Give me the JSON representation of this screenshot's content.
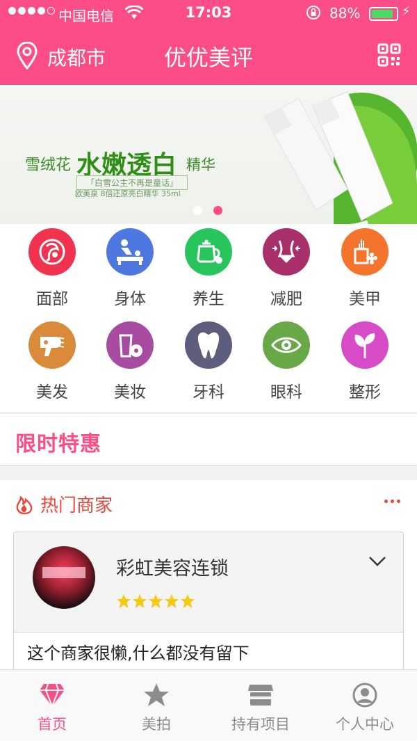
{
  "status_bar": {
    "carrier": "中国电信",
    "time": "17:03",
    "battery": "88%",
    "battery_level": 0.88
  },
  "header": {
    "city": "成都市",
    "title": "优优美评",
    "location_icon": "location-pin-icon",
    "qr_icon": "qr-code-icon"
  },
  "banner": {
    "text_left": "雪绒花",
    "text_main": "水嫩透白",
    "text_right": "精华",
    "slogan": "「白雪公主不再是童话」",
    "product_line": "欧美泉 8倍还原亮白精华 35ml",
    "active_slide": 2,
    "slides": 2
  },
  "categories": [
    {
      "label": "面部",
      "icon": "face-icon",
      "color": "#f0334f"
    },
    {
      "label": "身体",
      "icon": "massage-icon",
      "color": "#4e77e0"
    },
    {
      "label": "养生",
      "icon": "teapot-icon",
      "color": "#27c55c"
    },
    {
      "label": "减肥",
      "icon": "waist-icon",
      "color": "#a92f6a"
    },
    {
      "label": "美甲",
      "icon": "nail-bottle-icon",
      "color": "#f5742b"
    },
    {
      "label": "美发",
      "icon": "hair-dryer-icon",
      "color": "#d98b3b"
    },
    {
      "label": "美妆",
      "icon": "cosmetics-icon",
      "color": "#a74ca0"
    },
    {
      "label": "牙科",
      "icon": "tooth-icon",
      "color": "#5d5d7d"
    },
    {
      "label": "眼科",
      "icon": "eye-icon",
      "color": "#68a847"
    },
    {
      "label": "整形",
      "icon": "leaf-icon",
      "color": "#d74bc8"
    }
  ],
  "promo": {
    "title": "限时特惠"
  },
  "hot": {
    "title": "热门商家",
    "merchant": {
      "name": "彩虹美容连锁",
      "rating": 5,
      "description": "这个商家很懒,什么都没有留下"
    }
  },
  "tabs": [
    {
      "label": "首页",
      "icon": "diamond-icon",
      "active": true
    },
    {
      "label": "美拍",
      "icon": "star-icon",
      "active": false
    },
    {
      "label": "持有项目",
      "icon": "shop-icon",
      "active": false
    },
    {
      "label": "个人中心",
      "icon": "user-icon",
      "active": false
    }
  ],
  "colors": {
    "brand": "#fd4d86",
    "hot_red": "#e9473a",
    "star": "#f6c918",
    "banner_green": "#2f8e16"
  }
}
